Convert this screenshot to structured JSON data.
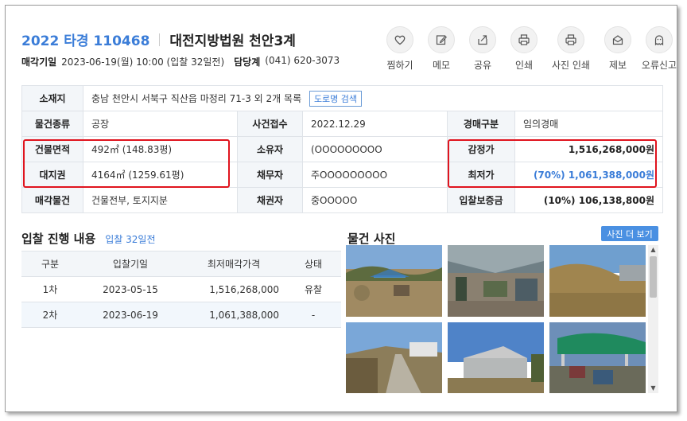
{
  "header": {
    "case_number": "2022 타경 110468",
    "court": "대전지방법원 천안3계",
    "sale_date_label": "매각기일",
    "sale_date_value": "2023-06-19(월) 10:00 (입찰 32일전)",
    "dept_label": "담당계",
    "dept_phone": "(041) 620-3073"
  },
  "actions": [
    {
      "label": "찜하기",
      "icon": "heart-icon"
    },
    {
      "label": "메모",
      "icon": "memo-icon"
    },
    {
      "label": "공유",
      "icon": "share-icon"
    },
    {
      "label": "인쇄",
      "icon": "print-icon"
    },
    {
      "label": "사진 인쇄",
      "icon": "print-icon"
    },
    {
      "label": "제보",
      "icon": "report-icon"
    },
    {
      "label": "오류신고",
      "icon": "ghost-icon"
    }
  ],
  "info": {
    "location_label": "소재지",
    "location_value": "충남 천안시 서북구 직산읍 마정리 71-3 외 2개 목록",
    "road_search_button": "도로명 검색",
    "type_label": "물건종류",
    "type_value": "공장",
    "case_received_label": "사건접수",
    "case_received_value": "2022.12.29",
    "auction_type_label": "경매구분",
    "auction_type_value": "임의경매",
    "building_area_label": "건물면적",
    "building_area_value": "492㎡ (148.83평)",
    "owner_label": "소유자",
    "owner_value": "(OOOOOOOOO",
    "appraisal_label": "감정가",
    "appraisal_value": "1,516,268,000원",
    "land_right_label": "대지권",
    "land_right_value": "4164㎡ (1259.61평)",
    "debtor_label": "채무자",
    "debtor_value": "주OOOOOOOOO",
    "minimum_label": "최저가",
    "minimum_value": "(70%) 1,061,388,000원",
    "sale_object_label": "매각물건",
    "sale_object_value": "건물전부, 토지지분",
    "creditor_label": "채권자",
    "creditor_value": "중OOOOO",
    "deposit_label": "입찰보증금",
    "deposit_value": "(10%) 106,138,800원"
  },
  "bidding": {
    "title": "입찰 진행 내용",
    "dday": "입찰 32일전",
    "columns": [
      "구분",
      "입찰기일",
      "최저매각가격",
      "상태"
    ],
    "rows": [
      [
        "1차",
        "2023-05-15",
        "1,516,268,000",
        "유찰"
      ],
      [
        "2차",
        "2023-06-19",
        "1,061,388,000",
        "-"
      ]
    ]
  },
  "photos": {
    "title": "물건 사진",
    "more_button": "사진 더 보기"
  },
  "colors": {
    "accent": "#3b7dd8",
    "highlight_border": "#e0141e",
    "button_blue": "#4a90e2"
  }
}
